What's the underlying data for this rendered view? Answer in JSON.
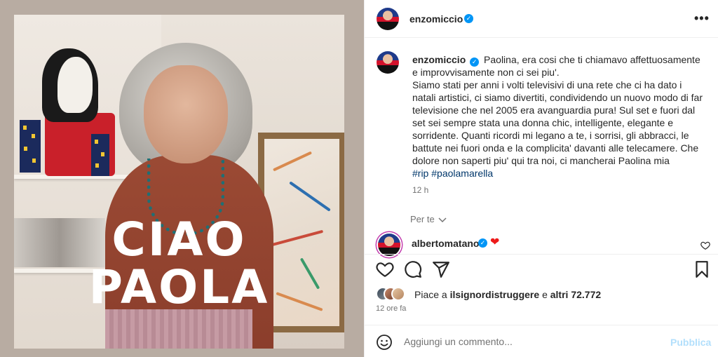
{
  "post": {
    "image_text_line1": "CIAO",
    "image_text_line2": "PAOLA"
  },
  "header": {
    "username": "enzomiccio",
    "verified_mark": "✓"
  },
  "caption": {
    "username": "enzomiccio",
    "text_line1": "Paolina, era cosi che ti chiamavo affettuosamente e improvvisamente non ci sei piu'.",
    "text_body": "Siamo stati per anni i volti televisivi di una rete che ci ha dato i natali artistici, ci siamo divertiti, condividendo un nuovo modo di far televisione che nel 2005 era avanguardia pura! Sul set e fuori dal set sei sempre stata una donna chic, intelligente, elegante e sorridente. Quanti ricordi mi legano a te, i sorrisi, gli abbracci, le battute nei fuori onda e la complicita' davanti alle telecamere. Che dolore non saperti piu' qui tra noi, ci mancherai Paolina mia",
    "hashtag1": "#rip",
    "hashtag2": "#paolamarella",
    "time": "12 h"
  },
  "per_te": {
    "label": "Per te"
  },
  "top_comment": {
    "username": "albertomatano",
    "emoji": "❤"
  },
  "likes": {
    "prefix": "Piace a",
    "user": "ilsignordistruggere",
    "connector": "e",
    "others": "altri 72.772"
  },
  "posted_ago": "12 ore fa",
  "comment_box": {
    "placeholder": "Aggiungi un commento...",
    "publish_label": "Pubblica"
  },
  "colors": {
    "link_blue": "#00376b",
    "verified_blue": "#0095f6",
    "publish_disabled": "#b2dffc",
    "heart_red": "#ed1a1a"
  },
  "icons": [
    "more-icon",
    "heart-icon",
    "comment-icon",
    "share-icon",
    "bookmark-icon",
    "emoji-icon",
    "chevron-down-icon",
    "verified-icon"
  ]
}
